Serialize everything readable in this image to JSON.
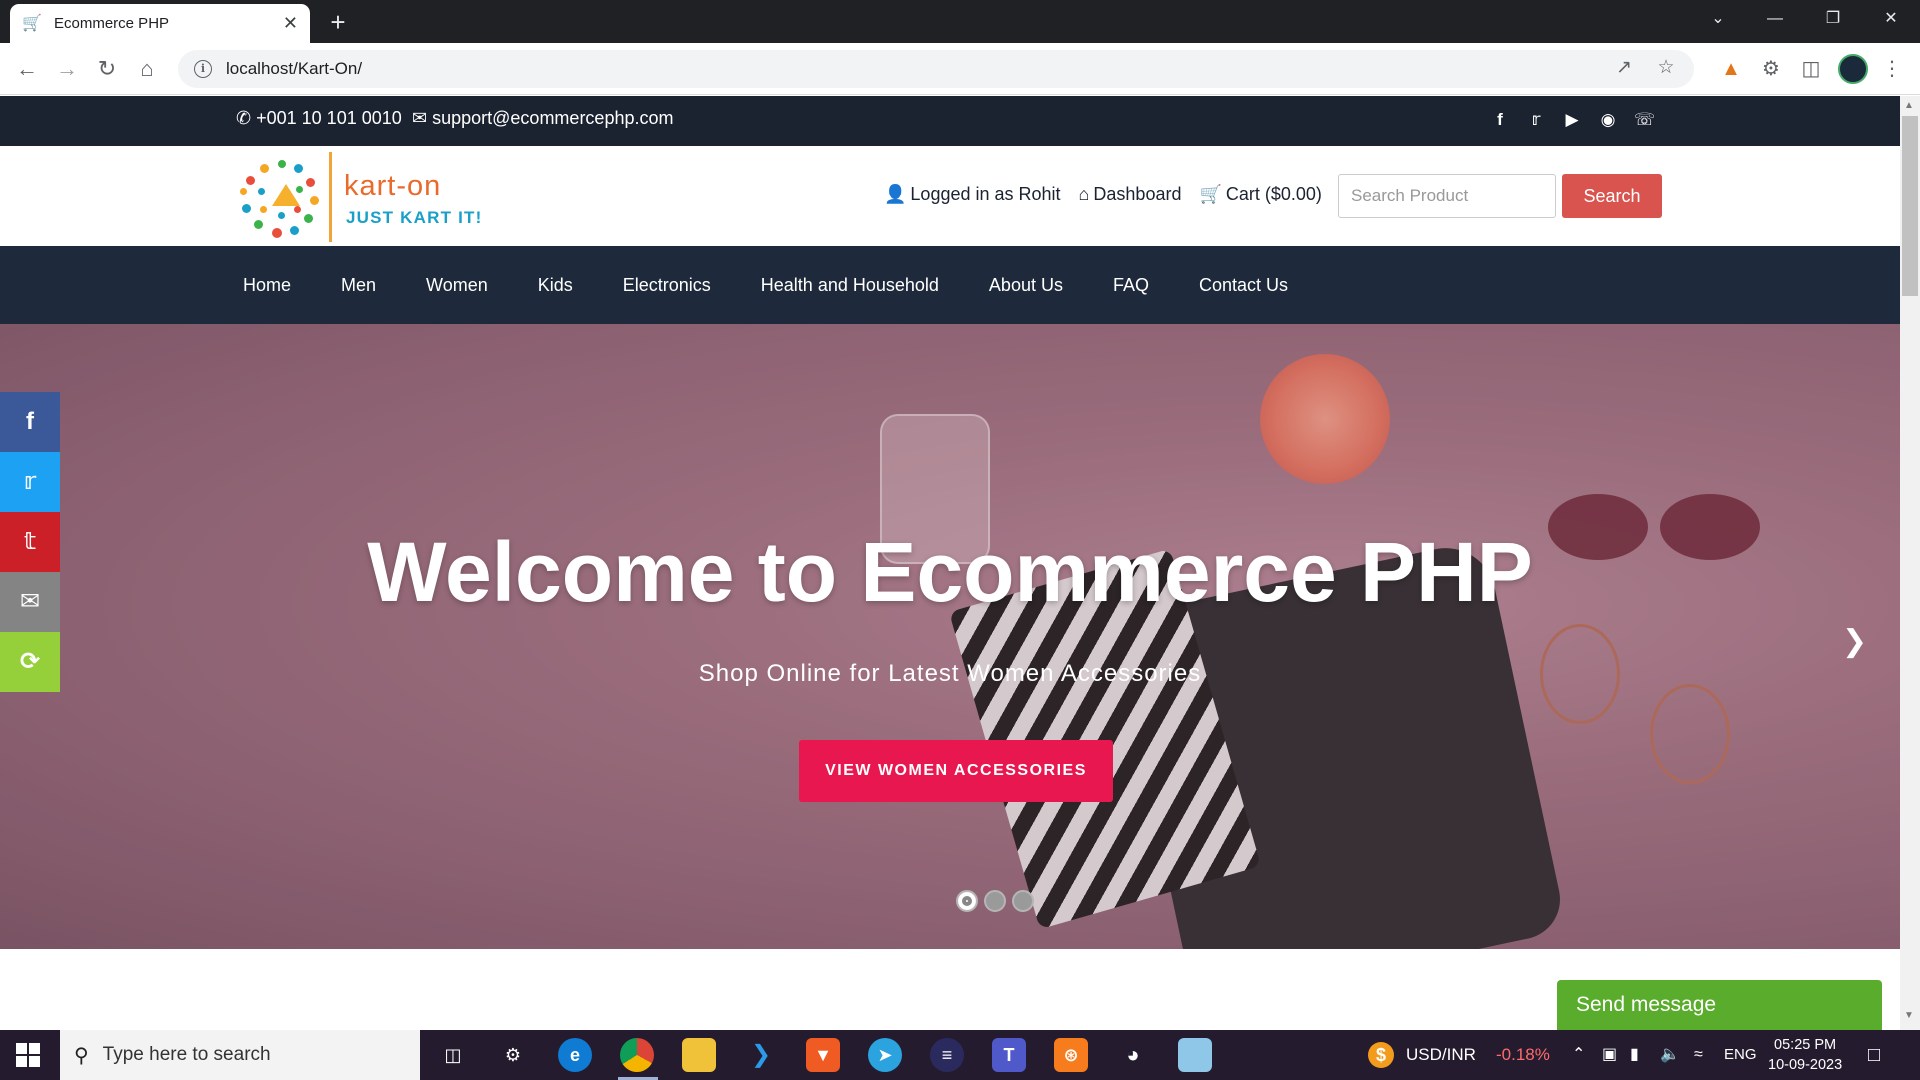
{
  "browser": {
    "tab_title": "Ecommerce PHP",
    "tab_close": "✕",
    "new_tab": "+",
    "url": "localhost/Kart-On/",
    "window_controls": [
      "⌄",
      "—",
      "❐",
      "✕"
    ]
  },
  "topbar": {
    "phone": "+001 10 101 0010",
    "email": "support@ecommercephp.com",
    "socials": [
      "facebook-icon",
      "twitter-icon",
      "youtube-icon",
      "instagram-icon",
      "whatsapp-icon"
    ]
  },
  "header": {
    "logo_name": "kart-on",
    "logo_tagline": "JUST KART IT!",
    "logged_in": "Logged in as Rohit",
    "dashboard": "Dashboard",
    "cart": "Cart ($0.00)",
    "search_placeholder": "Search Product",
    "search_button": "Search"
  },
  "nav": {
    "items": [
      "Home",
      "Men",
      "Women",
      "Kids",
      "Electronics",
      "Health and Household",
      "About Us",
      "FAQ",
      "Contact Us"
    ]
  },
  "hero": {
    "title": "Welcome to Ecommerce PHP",
    "subtitle": "Shop Online for Latest Women Accessories",
    "cta": "VIEW WOMEN ACCESSORIES",
    "slide_count": 3,
    "active_slide": 1
  },
  "share_rail": [
    {
      "name": "facebook-share",
      "color": "#3b5998"
    },
    {
      "name": "twitter-share",
      "color": "#1da1f2"
    },
    {
      "name": "pinterest-share",
      "color": "#cb2027"
    },
    {
      "name": "email-share",
      "color": "#848484"
    },
    {
      "name": "more-share",
      "color": "#95d03a"
    }
  ],
  "chat": {
    "send_message": "Send message"
  },
  "taskbar": {
    "search_placeholder": "Type here to search",
    "ticker_label": "USD/INR",
    "ticker_change": "-0.18%",
    "lang": "ENG",
    "time": "05:25 PM",
    "date": "10-09-2023"
  }
}
